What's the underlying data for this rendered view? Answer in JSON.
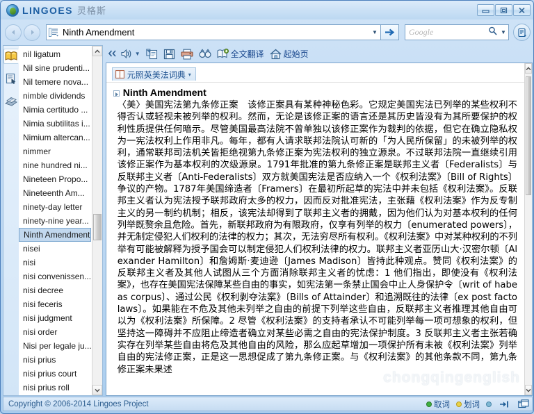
{
  "window": {
    "brand": "LINGOES",
    "brand_cn": "灵格斯",
    "logo_icon": "lingoes-parrot-icon",
    "buttons": {
      "minimize": "minimize-icon",
      "maximize": "maximize-icon",
      "close": "close-icon"
    }
  },
  "addressbar": {
    "back_icon": "back-arrow-icon",
    "forward_icon": "forward-arrow-icon",
    "list_icon": "word-list-icon",
    "value": "Ninth Amendment",
    "dropdown_icon": "chevron-down-icon",
    "go_icon": "go-arrow-icon",
    "search_placeholder": "Google",
    "search_icon": "magnifier-icon",
    "search_dropdown_icon": "chevron-down-icon",
    "extras_icon": "appbar-menu-icon"
  },
  "sidebar": {
    "icons": [
      {
        "name": "dictionary-icon",
        "active": true
      },
      {
        "name": "capture-icon",
        "active": false
      },
      {
        "name": "appendix-icon",
        "active": false
      }
    ],
    "words": [
      "nil ligatum",
      "Nil sine prudenti...",
      "Nil temere nova...",
      "nimble dividends",
      "Nimia certitudo ...",
      "Nimia subtilitas i...",
      "Nimium altercan...",
      "nimmer",
      "nine hundred ni...",
      "Nineteen Propo...",
      "Nineteenth Am...",
      "ninety-day letter",
      "ninety-nine year...",
      "Ninth Amendment",
      "nisei",
      "nisi",
      "nisi convenissen...",
      "nisi decree",
      "nisi feceris",
      "nisi judgment",
      "nisi order",
      "Nisi per legale ju...",
      "nisi prius",
      "nisi prius court",
      "nisi prius roll"
    ],
    "selected_word": "Ninth Amendment",
    "scroll_up_icon": "chevron-up-icon",
    "scroll_down_icon": "chevron-down-icon"
  },
  "toolbar": {
    "items": [
      {
        "name": "collapse-left-icon",
        "label": "«",
        "type": "chevron"
      },
      {
        "name": "speaker-icon",
        "label": "",
        "type": "icon-dropdown"
      },
      {
        "name": "copy-icon",
        "label": "",
        "type": "icon"
      },
      {
        "name": "save-icon",
        "label": "",
        "type": "icon"
      },
      {
        "name": "print-icon",
        "label": "",
        "type": "icon"
      },
      {
        "name": "find-icon",
        "label": "",
        "type": "icon"
      },
      {
        "name": "full-text-translate-icon",
        "label": "全文翻译",
        "type": "icon-text"
      },
      {
        "name": "home-page-icon",
        "label": "起始页",
        "type": "icon-text"
      }
    ]
  },
  "content": {
    "dictionary_tab": {
      "icon": "book-icon",
      "label": "元照英美法词典",
      "caret": "▾"
    },
    "entry_title": "Ninth Amendment",
    "entry_body": "〈美〉美国宪法第九条修正案　该修正案具有某种神秘色彩。它规定美国宪法已列举的某些权利不得否认或轻视未被列举的权利。然而，无论是该修正案的语言还是其历史皆没有为其所要保护的权利性质提供任何暗示。尽管美国最高法院不曾单独以该修正案作为裁判的依据，但它在确立隐私权为一宪法权利上作用非凡。每年，都有人请求联邦法院认可新的「为人民所保留」的未被列举的权利，通常联邦司法机关皆拒绝视第九条修正案为宪法权利的独立源泉。不过联邦法院一直继续引用该修正案作为基本权利的次级源泉。1791年批准的第九条修正案是联邦主义者〔Federalists〕与反联邦主义者〔Anti-Federalists〕双方就美国宪法是否应纳入一个《权利法案》〔Bill of Rights〕争议的产物。1787年美国缔造者〔Framers〕在最初所起草的宪法中并未包括《权利法案》。反联邦主义者认为宪法授予联邦政府太多的权力，因而反对批准宪法，主张藉《权利法案》作为反专制主义的另一制约机制；相反，该宪法却得到了联邦主义者的拥戴，因为他们认为对基本权利的任何列举既赘余且危险。首先，新联邦政府为有限政府，仅享有列举的权力〔enumerated powers〕，并无制定侵犯人们权利的法律的权力；其次，无法穷尽所有权利。《权利法案》中对某种权利的不列举有可能被解释为授予国会可以制定侵犯人们权利法律的权力。联邦主义者亚历山大·汉密尔顿〔Alexander Hamilton〕和詹姆斯·麦迪逊〔James Madison〕皆持此种观点。赞同《权利法案》的反联邦主义者及其他人试图从三个方面消除联邦主义者的忧虑：1 他们指出，即使没有《权利法案》，也存在美国宪法保障某些自由的事实，如宪法第一条禁止国会中止人身保护令〔writ of habeas corpus〕、通过公民《权利剥夺法案》〔Bills of Attainder〕和追溯既往的法律〔ex post facto laws〕。如果能在不危及其他未列举之自由的前提下列举这些自由，反联邦主义者推理其他自由可以为《权利法案》所保障。2 尽管《权利法案》的支持者承认不可能列举每一项可想象的权利，但坚持这一障碍并不应阻止缔造者确立对某些必需之自由的宪法保护制度。3 反联邦主义者主张若确实存在列举某些自由将危及其他自由的风险，那么应起草增加一项保护所有未被《权利法案》列举自由的宪法修正案，正是这一思想促成了第九条修正案。与《权利法案》的其他条款不同，第九条修正案未果述",
    "watermark": "chongqingenglish",
    "scroll_up_icon": "chevron-up-icon",
    "scroll_down_icon": "chevron-down-icon"
  },
  "statusbar": {
    "copyright": "Copyright © 2006-2014 Lingoes Project",
    "items": [
      {
        "name": "capture-word-status",
        "label": "取词",
        "dot_color": "#3faf3f"
      },
      {
        "name": "highlight-word-status",
        "label": "划词",
        "dot_color": "#e8d24a"
      },
      {
        "name": "misc-status",
        "label": "",
        "dot_color": "#5fa7c8"
      }
    ],
    "icons": [
      {
        "name": "pin-icon"
      },
      {
        "name": "window-mode-icon"
      }
    ]
  }
}
